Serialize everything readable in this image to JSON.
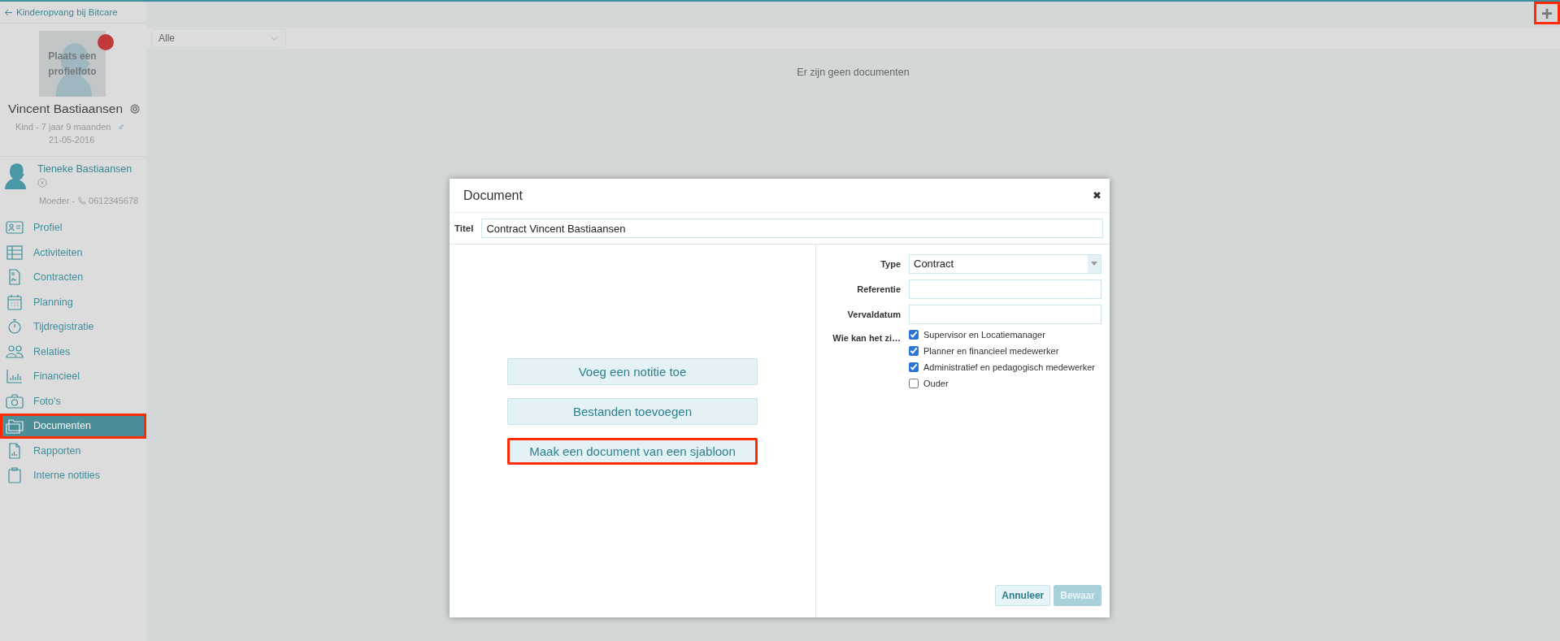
{
  "header": {
    "back_link": "Kinderopvang bij Bitcare",
    "add_button": {
      "label": "+",
      "highlighted": true
    }
  },
  "profile": {
    "photo_placeholder": "Plaats een profielfoto",
    "name": "Vincent Bastiaansen",
    "subtitle": "Kind - 7 jaar 9 maanden",
    "gender": "♂",
    "birthdate": "21-05-2016"
  },
  "relation": {
    "name": "Tieneke Bastiaansen",
    "role": "Moeder -",
    "phone": "0612345678"
  },
  "nav": [
    {
      "label": "Profiel",
      "selected": false,
      "highlighted": false
    },
    {
      "label": "Activiteiten",
      "selected": false,
      "highlighted": false
    },
    {
      "label": "Contracten",
      "selected": false,
      "highlighted": false
    },
    {
      "label": "Planning",
      "selected": false,
      "highlighted": false
    },
    {
      "label": "Tijdregistratie",
      "selected": false,
      "highlighted": false
    },
    {
      "label": "Relaties",
      "selected": false,
      "highlighted": false
    },
    {
      "label": "Financieel",
      "selected": false,
      "highlighted": false
    },
    {
      "label": "Foto's",
      "selected": false,
      "highlighted": false
    },
    {
      "label": "Documenten",
      "selected": true,
      "highlighted": true
    },
    {
      "label": "Rapporten",
      "selected": false,
      "highlighted": false
    },
    {
      "label": "Interne notities",
      "selected": false,
      "highlighted": false
    }
  ],
  "filter": {
    "value": "Alle"
  },
  "empty_message": "Er zijn geen documenten",
  "dialog": {
    "title": "Document",
    "close": "✖",
    "title_field": {
      "label": "Titel",
      "value": "Contract Vincent Bastiaansen"
    },
    "actions": [
      {
        "label": "Voeg een notitie toe",
        "highlighted": false
      },
      {
        "label": "Bestanden toevoegen",
        "highlighted": false
      },
      {
        "label": "Maak een document van een sjabloon",
        "highlighted": true
      }
    ],
    "type_field": {
      "label": "Type",
      "value": "Contract"
    },
    "fields": [
      {
        "label": "Referentie"
      },
      {
        "label": "Vervaldatum"
      }
    ],
    "visibility": {
      "label": "Wie kan het zi…",
      "options": [
        {
          "label": "Supervisor en Locatiemanager",
          "checked": true
        },
        {
          "label": "Planner en financieel medewerker",
          "checked": true
        },
        {
          "label": "Administratief en pedagogisch medewerker",
          "checked": true
        },
        {
          "label": "Ouder",
          "checked": false
        }
      ]
    },
    "buttons": [
      {
        "label": "Annuleer",
        "kind": "secondary",
        "disabled": false
      },
      {
        "label": "Bewaar",
        "kind": "primary",
        "disabled": true
      }
    ]
  }
}
